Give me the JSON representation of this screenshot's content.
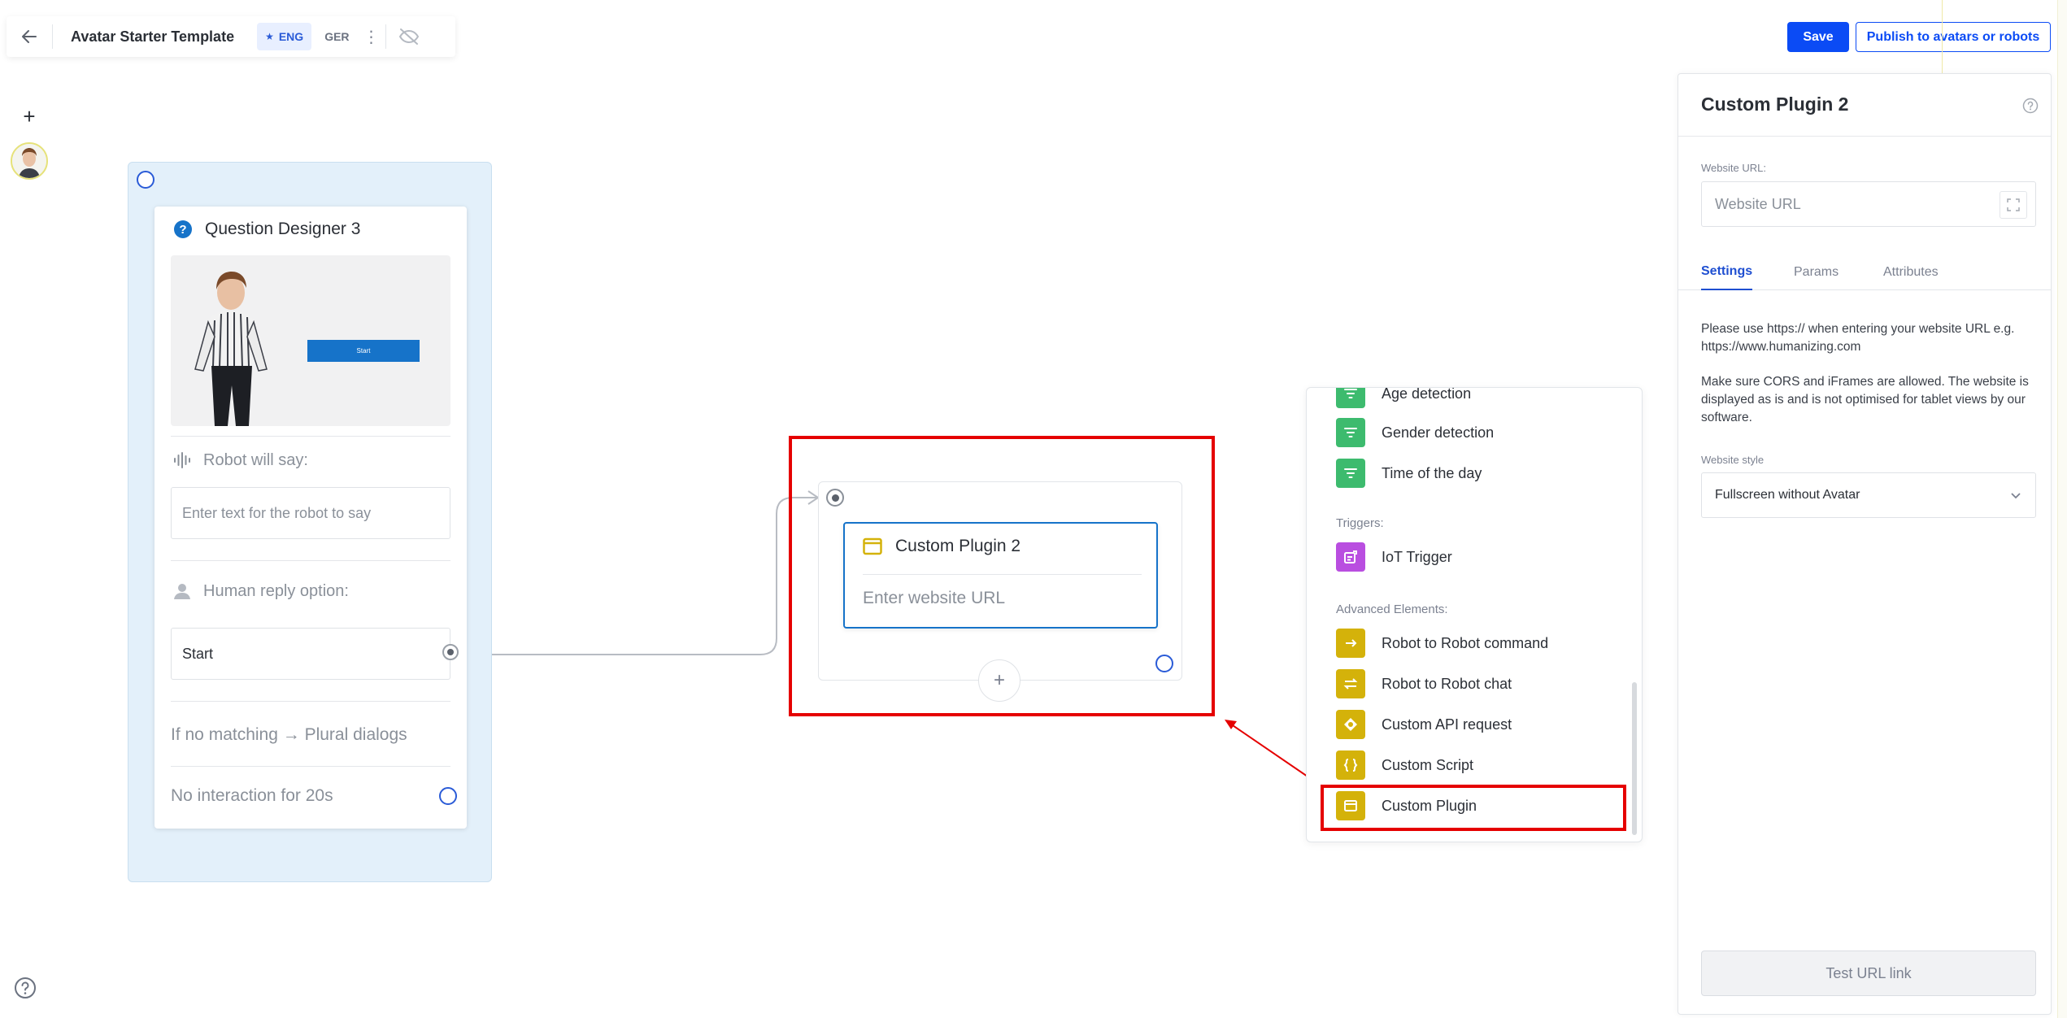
{
  "toolbar": {
    "template_name": "Avatar Starter Template",
    "languages": [
      {
        "code": "ENG",
        "active": true
      },
      {
        "code": "GER",
        "active": false
      }
    ]
  },
  "actions": {
    "save_label": "Save",
    "publish_label": "Publish to avatars or robots"
  },
  "question_designer": {
    "title": "Question Designer 3",
    "preview_button_label": "Start",
    "robot_say_label": "Robot will say:",
    "robot_say_placeholder": "Enter text for the robot to say",
    "human_reply_label": "Human reply option:",
    "human_reply_value": "Start",
    "no_match_text": "If no matching → Plural dialogs",
    "no_interaction_text": "No interaction for 20s"
  },
  "plugin_node": {
    "title": "Custom Plugin 2",
    "url_placeholder": "Enter website URL"
  },
  "palette": {
    "items_top": [
      {
        "label": "Age detection",
        "icon": "filter-icon",
        "color": "#3dbb6e"
      },
      {
        "label": "Gender detection",
        "icon": "filter-icon",
        "color": "#3dbb6e"
      },
      {
        "label": "Time of the day",
        "icon": "filter-icon",
        "color": "#3dbb6e"
      }
    ],
    "triggers_label": "Triggers:",
    "triggers": [
      {
        "label": "IoT Trigger",
        "icon": "iot-icon",
        "color": "#b94ee0"
      }
    ],
    "advanced_label": "Advanced Elements:",
    "advanced": [
      {
        "label": "Robot to Robot command",
        "icon": "arrow-right-icon",
        "color": "#d4b20a"
      },
      {
        "label": "Robot to Robot chat",
        "icon": "swap-icon",
        "color": "#d4b20a"
      },
      {
        "label": "Custom API request",
        "icon": "api-icon",
        "color": "#d4b20a"
      },
      {
        "label": "Custom Script",
        "icon": "braces-icon",
        "color": "#d4b20a"
      },
      {
        "label": "Custom Plugin",
        "icon": "window-icon",
        "color": "#d4b20a"
      }
    ]
  },
  "right_panel": {
    "title": "Custom Plugin 2",
    "website_url_label": "Website URL:",
    "website_url_placeholder": "Website URL",
    "tabs": [
      {
        "label": "Settings",
        "active": true
      },
      {
        "label": "Params",
        "active": false
      },
      {
        "label": "Attributes",
        "active": false
      }
    ],
    "info_1": "Please use https:// when entering your website URL e.g. https://www.humanizing.com",
    "info_2": "Make sure CORS and iFrames are allowed. The website is displayed as is and is not optimised for tablet views by our software.",
    "website_style_label": "Website style",
    "website_style_value": "Fullscreen without Avatar",
    "test_button_label": "Test URL link"
  },
  "colors": {
    "primary": "#0b4bf5",
    "highlight": "#e50000",
    "card_border_selected": "#1673c9",
    "group_bg": "#e3f0fa"
  }
}
